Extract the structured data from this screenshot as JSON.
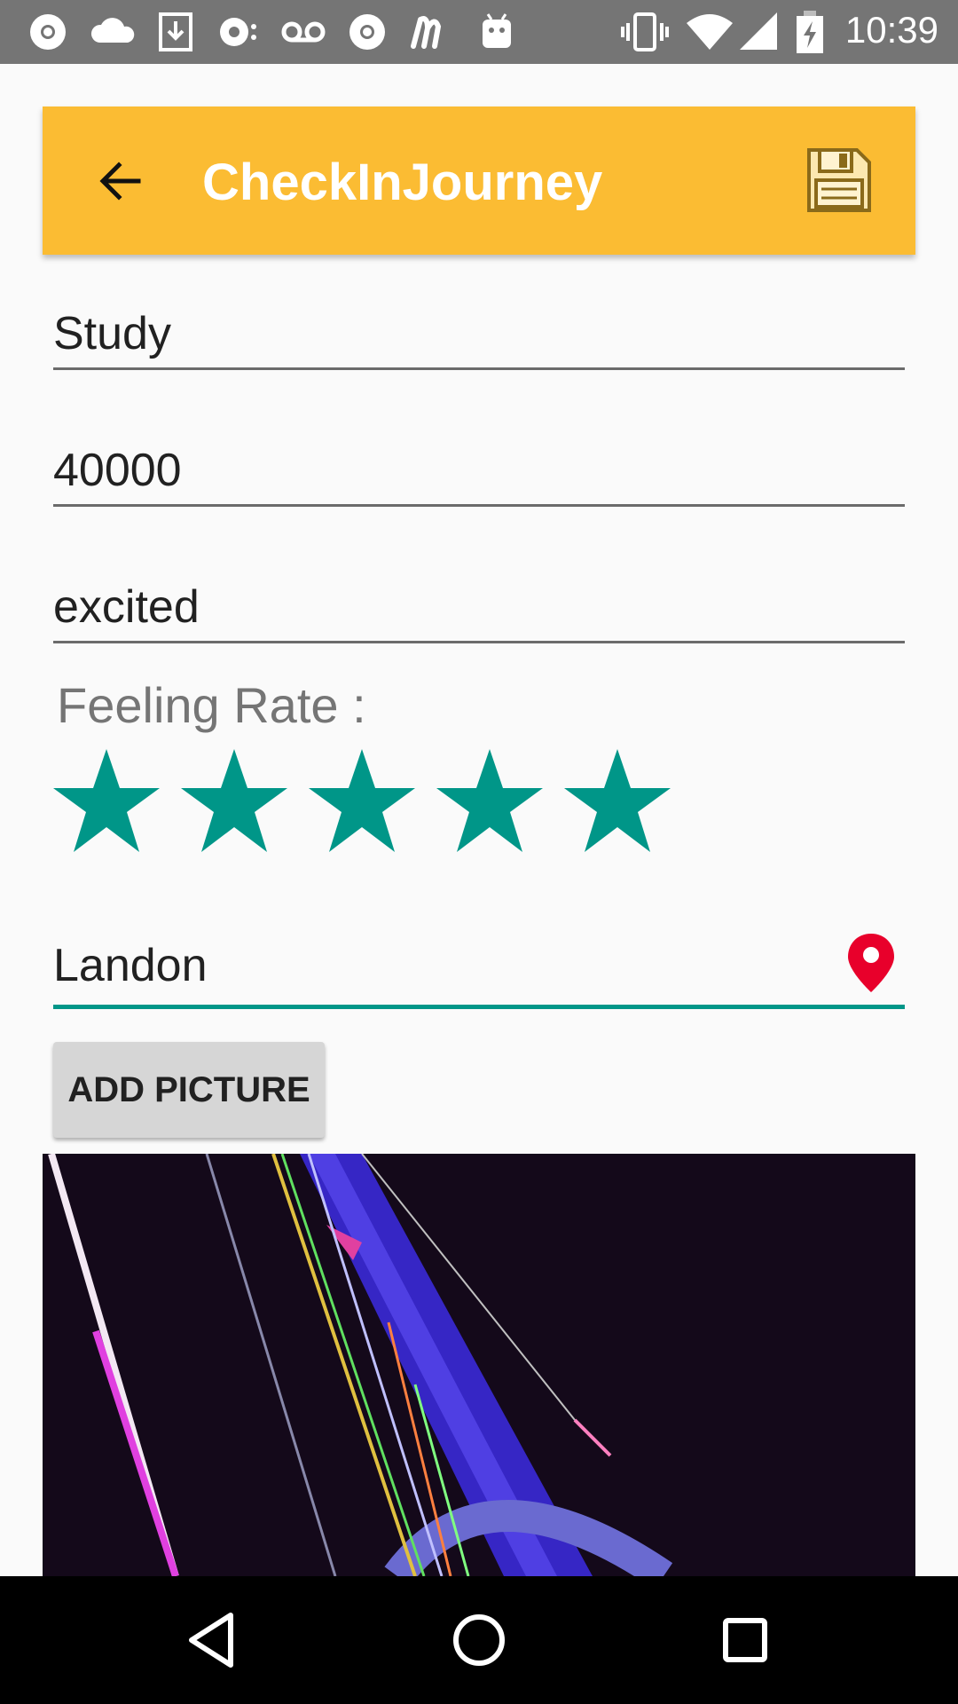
{
  "status_bar": {
    "time": "10:39",
    "left_icons": [
      "chrome-icon",
      "cloud-icon",
      "download-icon",
      "stream-icon",
      "voicemail-icon",
      "chrome-icon",
      "m-app-icon",
      "android-icon"
    ],
    "right_icons": [
      "vibrate-icon",
      "wifi-icon",
      "signal-icon",
      "battery-charging-icon"
    ]
  },
  "app_bar": {
    "title": "CheckInJourney",
    "background": "#FBBC33"
  },
  "form": {
    "title_value": "Study",
    "amount_value": "40000",
    "mood_value": "excited",
    "feeling_rate_label": "Feeling Rate :",
    "rating": 5,
    "rating_max": 5,
    "location_value": "Landon",
    "add_picture_label": "ADD PICTURE"
  },
  "colors": {
    "accent": "#009688",
    "pin": "#E8002B",
    "status_bar": "#757575"
  },
  "nav_bar": {
    "buttons": [
      "back-triangle-icon",
      "home-circle-icon",
      "recents-square-icon"
    ]
  }
}
